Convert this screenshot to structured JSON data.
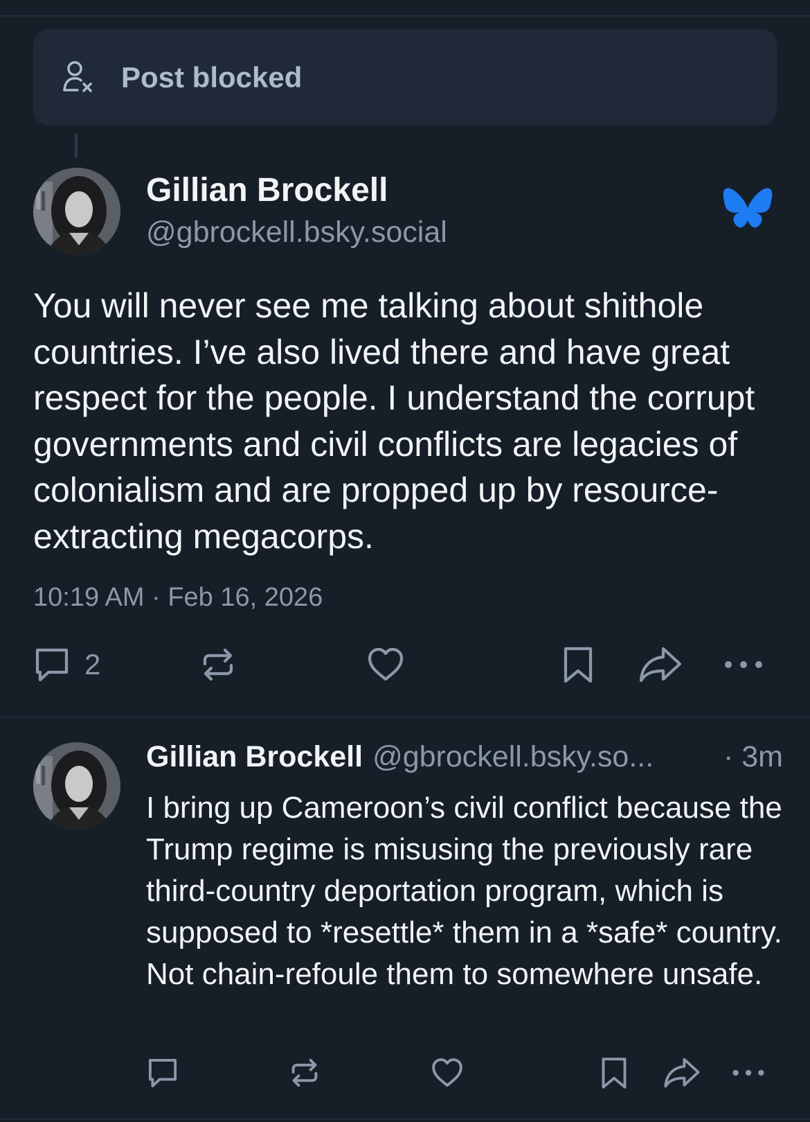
{
  "blocked": {
    "label": "Post blocked",
    "icon": "person-x-icon"
  },
  "post": {
    "author_name": "Gillian Brockell",
    "author_handle": "@gbrockell.bsky.social",
    "badge_icon": "bluesky-butterfly-icon",
    "text": "You will never see me talking about shithole countries. I’ve also lived there and have great respect for the people. I understand the corrupt governments and civil conflicts are legacies of colonialism and are propped up by resource-extracting megacorps.",
    "timestamp": "10:19 AM · Feb 16, 2026",
    "reply_count": "2",
    "actions": [
      "reply-icon",
      "repost-icon",
      "like-icon",
      "bookmark-icon",
      "share-icon",
      "more-icon"
    ]
  },
  "reply": {
    "author_name": "Gillian Brockell",
    "author_handle": "@gbrockell.bsky.so...",
    "age": "· 3m",
    "text": "I bring up Cameroon’s civil conflict because the Trump regime is misusing the previously rare third-country deportation program, which is supposed to *resettle* them in a *safe* country. Not chain-refoule them to somewhere unsafe."
  },
  "colors": {
    "background": "#161e27",
    "card": "#1f2937",
    "muted_text": "#8b98a9",
    "accent_blue": "#1d7cf2"
  }
}
